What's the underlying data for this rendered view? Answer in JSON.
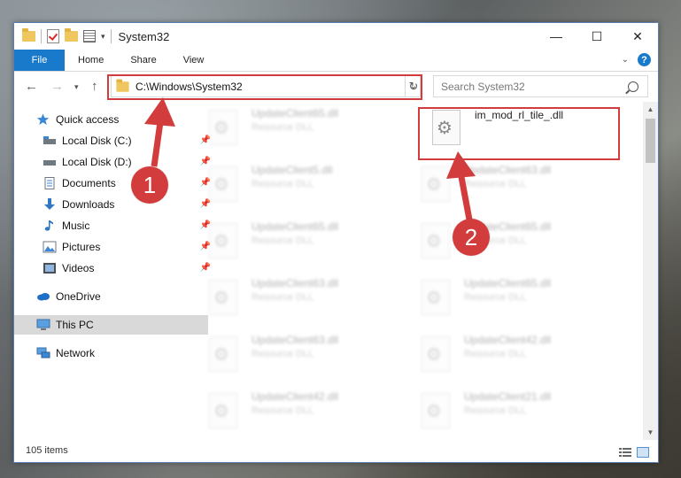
{
  "window": {
    "title": "System32",
    "controls": {
      "minimize": "—",
      "maximize": "☐",
      "close": "✕"
    }
  },
  "ribbon": {
    "tabs": [
      "File",
      "Home",
      "Share",
      "View"
    ],
    "help": "?"
  },
  "nav": {
    "address": "C:\\Windows\\System32",
    "search_placeholder": "Search System32"
  },
  "sidebar": {
    "items": [
      {
        "label": "Quick access",
        "icon": "star-icon",
        "pinned": false
      },
      {
        "label": "Local Disk (C:)",
        "icon": "drive-icon",
        "pinned": true
      },
      {
        "label": "Local Disk (D:)",
        "icon": "drive-icon",
        "pinned": true
      },
      {
        "label": "Documents",
        "icon": "documents-icon",
        "pinned": true
      },
      {
        "label": "Downloads",
        "icon": "download-icon",
        "pinned": true
      },
      {
        "label": "Music",
        "icon": "music-icon",
        "pinned": true
      },
      {
        "label": "Pictures",
        "icon": "pictures-icon",
        "pinned": true
      },
      {
        "label": "Videos",
        "icon": "videos-icon",
        "pinned": true
      },
      {
        "label": "OneDrive",
        "icon": "cloud-icon",
        "pinned": false
      },
      {
        "label": "This PC",
        "icon": "computer-icon",
        "pinned": false,
        "selected": true
      },
      {
        "label": "Network",
        "icon": "network-icon",
        "pinned": false
      }
    ]
  },
  "files": {
    "left": [
      {
        "name": "UpdateClient65.dll",
        "type": "Resource DLL"
      },
      {
        "name": "UpdateClient5.dll",
        "type": "Resource DLL"
      },
      {
        "name": "UpdateClient65.dll",
        "type": "Resource DLL"
      },
      {
        "name": "UpdateClient63.dll",
        "type": "Resource DLL"
      },
      {
        "name": "UpdateClient63.dll",
        "type": "Resource DLL"
      },
      {
        "name": "UpdateClient42.dll",
        "type": "Resource DLL"
      }
    ],
    "right": [
      {
        "name": "im_mod_rl_tile_.dll",
        "type": ""
      },
      {
        "name": "UpdateClient63.dll",
        "type": "Resource DLL"
      },
      {
        "name": "UpdateClient65.dll",
        "type": "Resource DLL"
      },
      {
        "name": "UpdateClient65.dll",
        "type": "Resource DLL"
      },
      {
        "name": "UpdateClient42.dll",
        "type": "Resource DLL"
      },
      {
        "name": "UpdateClient21.dll",
        "type": "Resource DLL"
      }
    ]
  },
  "status": {
    "count": "105 items"
  },
  "annotations": {
    "step1": "1",
    "step2": "2",
    "color": "#d23c3c"
  }
}
